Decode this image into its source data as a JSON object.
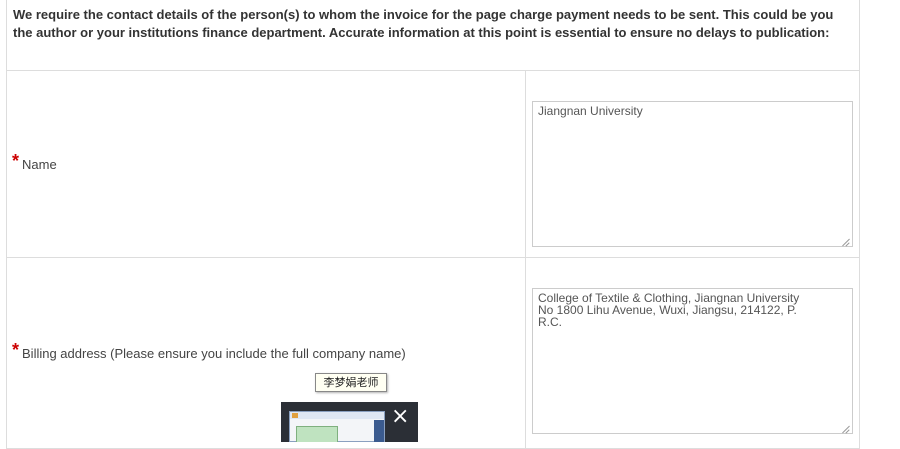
{
  "intro_text": "We require the contact details of the person(s) to whom the invoice for the page charge payment needs to be sent. This could be you the author or your institutions finance department. Accurate information at this point is essential to ensure no delays to publication:",
  "required_mark": "*",
  "fields": {
    "name": {
      "label": "Name",
      "value": "Jiangnan University"
    },
    "billing_address": {
      "label": "Billing address (Please ensure you include the full company name)",
      "value": "College of Textile & Clothing, Jiangnan University\nNo 1800 Lihu Avenue, Wuxi, Jiangsu, 214122, P.\nR.C."
    }
  },
  "taskbar_popup": {
    "tooltip": "李梦娟老师",
    "close_glyph": "×"
  }
}
